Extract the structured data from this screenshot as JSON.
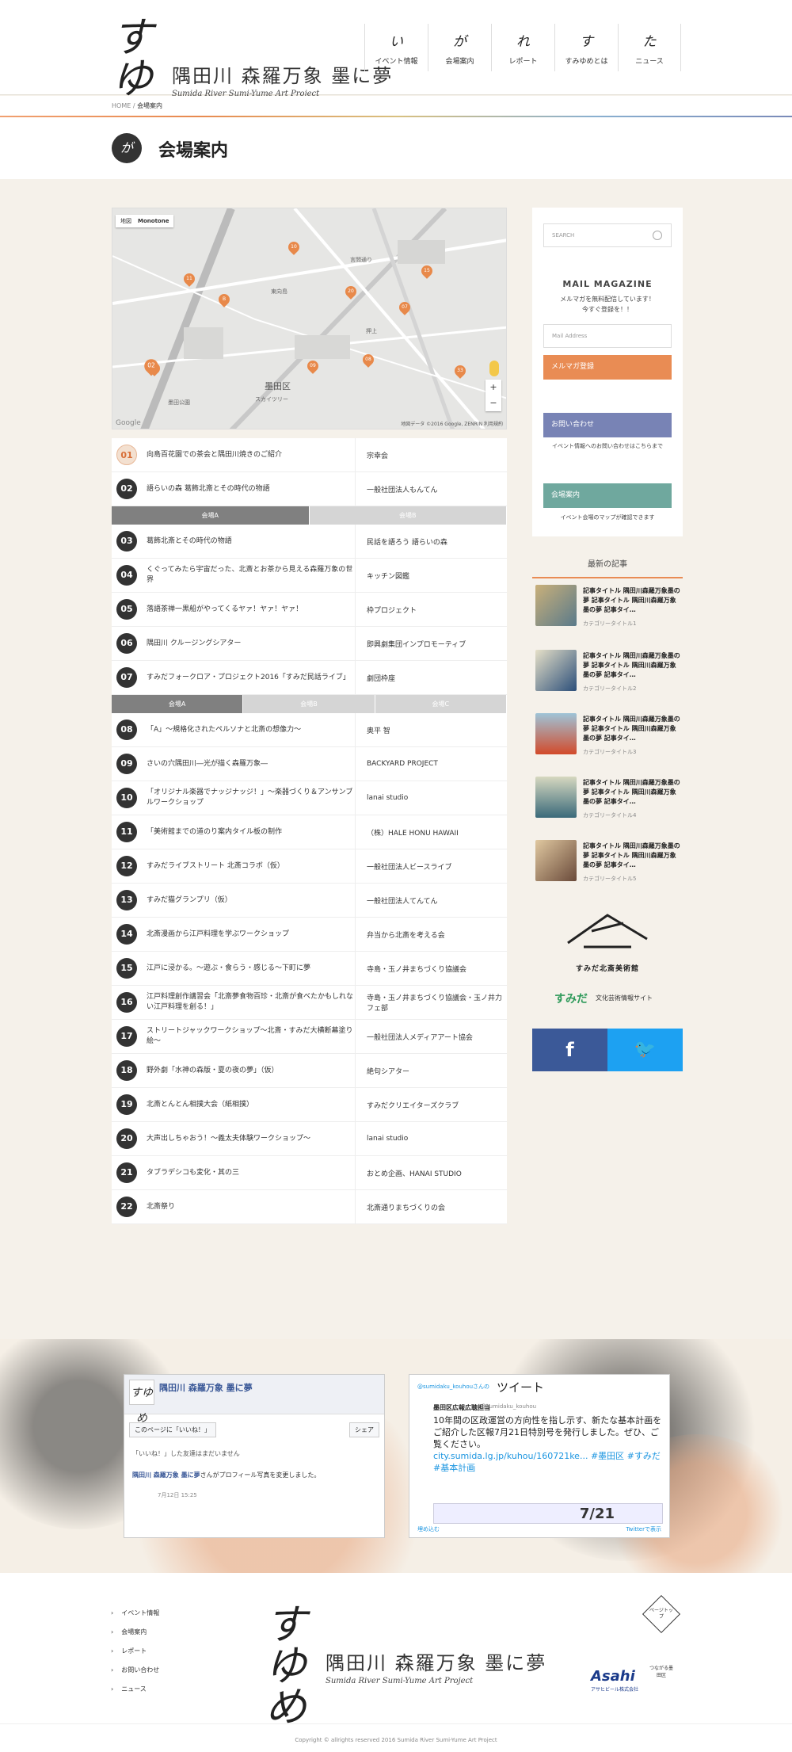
{
  "header": {
    "logo_mark": "すゆめ",
    "logo_jp": "隅田川 森羅万象 墨に夢",
    "logo_en": "Sumida River Sumi-Yume Art Project",
    "nav": [
      {
        "kana": "い",
        "label": "イベント情報"
      },
      {
        "kana": "が",
        "label": "会場案内"
      },
      {
        "kana": "れ",
        "label": "レポート"
      },
      {
        "kana": "す",
        "label": "すみゆめとは"
      },
      {
        "kana": "た",
        "label": "ニュース"
      }
    ]
  },
  "breadcrumb": {
    "home": "HOME",
    "sep": " / ",
    "current": "会場案内"
  },
  "page": {
    "icon": "が",
    "title": "会場案内"
  },
  "map": {
    "type_label": "地図",
    "style_label": "Monotone",
    "ward_label": "墨田区",
    "credit": "地図データ ©2016 Google, ZENRIN 利用規約",
    "google": "Google",
    "area_labels": [
      "東向島",
      "押上",
      "スカイツリー",
      "言問通り",
      "墨田公園"
    ],
    "pins": [
      "A",
      "B",
      "02",
      "11",
      "10",
      "20",
      "07",
      "15",
      "09",
      "08",
      "33"
    ]
  },
  "list_top": [
    {
      "num": "01",
      "event": "向島百花園での茶会と隅田川焼きのご紹介",
      "org": "宗幸会",
      "highlight": true
    },
    {
      "num": "02",
      "event": "語らいの森 葛飾北斎とその時代の物語",
      "org": "一般社団法人もんてん",
      "highlight": false
    }
  ],
  "tabs_1": [
    "会場A",
    "会場B"
  ],
  "list_mid": [
    {
      "num": "03",
      "event": "葛飾北斎とその時代の物語",
      "org": "民話を語ろう 語らいの森"
    },
    {
      "num": "04",
      "event": "くぐってみたら宇宙だった、北斎とお茶から見える森羅万象の世界",
      "org": "キッチン図鑑"
    },
    {
      "num": "05",
      "event": "落語茶禅一黒船がやってくるヤァ！ヤァ！ヤァ！",
      "org": "枠プロジェクト"
    },
    {
      "num": "06",
      "event": "隅田川 クルージングシアター",
      "org": "即興劇集団インプロモーティブ"
    },
    {
      "num": "07",
      "event": "すみだフォークロア・プロジェクト2016「すみだ民話ライブ」",
      "org": "劇団枠座"
    }
  ],
  "tabs_2": [
    "会場A",
    "会場B",
    "会場C"
  ],
  "list_bottom": [
    {
      "num": "08",
      "event": "「A」～規格化されたペルソナと北斎の想像力～",
      "org": "奥平 智"
    },
    {
      "num": "09",
      "event": "さいの穴隅田川―光が描く森羅万象―",
      "org": "BACKYARD PROJECT"
    },
    {
      "num": "10",
      "event": "「オリジナル楽器でナッジナッジ！」～楽器づくり＆アンサンブルワークショップ",
      "org": "lanai studio"
    },
    {
      "num": "11",
      "event": "「美術館までの道のり案内タイル板の制作",
      "org": "（株）HALE HONU HAWAII"
    },
    {
      "num": "12",
      "event": "すみだライブストリート 北斎コラボ（仮）",
      "org": "一般社団法人ビースライブ"
    },
    {
      "num": "13",
      "event": "すみだ猫グランプリ（仮）",
      "org": "一般社団法人てんてん"
    },
    {
      "num": "14",
      "event": "北斎漫画から江戸料理を学ぶワークショップ",
      "org": "弁当から北斎を考える会"
    },
    {
      "num": "15",
      "event": "江戸に浸かる。～遊ぶ・食らう・感じる～下町に夢",
      "org": "寺島・玉ノ井まちづくり協議会"
    },
    {
      "num": "16",
      "event": "江戸料理創作講習会「北斎夢食物百珍・北斎が食べたかもしれない江戸料理を創る！」",
      "org": "寺島・玉ノ井まちづくり協議会・玉ノ井力フェ部"
    },
    {
      "num": "17",
      "event": "ストリートジャックワークショップ～北斎・すみだ大横断幕塗り絵～",
      "org": "一般社団法人メディアアート協会"
    },
    {
      "num": "18",
      "event": "野外劇「水神の森版・夏の夜の夢」（仮）",
      "org": "絶句シアター"
    },
    {
      "num": "19",
      "event": "北斎とんとん相撲大会（紙相撲）",
      "org": "すみだクリエイターズクラブ"
    },
    {
      "num": "20",
      "event": "大声出しちゃおう！～義太夫体験ワークショップ～",
      "org": "lanai studio"
    },
    {
      "num": "21",
      "event": "タブラデシコも変化・其の三",
      "org": "おとめ企画、HANAI STUDIO"
    },
    {
      "num": "22",
      "event": "北斎祭り",
      "org": "北斎通りまちづくりの会"
    }
  ],
  "sidebar": {
    "search_placeholder": "SEARCH",
    "mm_title": "MAIL MAGAZINE",
    "mm_text_1": "メルマガを無料配信しています！",
    "mm_text_2": "今すぐ登録を！！",
    "mm_placeholder": "Mail Address",
    "mm_button": "メルマガ登録",
    "contact_button": "お問い合わせ",
    "contact_sub": "イベント情報へのお問い合わせはこちらまで",
    "venue_button": "会場案内",
    "venue_sub": "イベント会場のマップが確認できます"
  },
  "recent": {
    "title": "最新の記事",
    "items": [
      {
        "title": "記事タイトル 隅田川森羅万象墨の夢 記事タイトル 隅田川森羅万象墨の夢 記事タイ…",
        "cat": "カテゴリータイトル1"
      },
      {
        "title": "記事タイトル 隅田川森羅万象墨の夢 記事タイトル 隅田川森羅万象墨の夢 記事タイ…",
        "cat": "カテゴリータイトル2"
      },
      {
        "title": "記事タイトル 隅田川森羅万象墨の夢 記事タイトル 隅田川森羅万象墨の夢 記事タイ…",
        "cat": "カテゴリータイトル3"
      },
      {
        "title": "記事タイトル 隅田川森羅万象墨の夢 記事タイトル 隅田川森羅万象墨の夢 記事タイ…",
        "cat": "カテゴリータイトル4"
      },
      {
        "title": "記事タイトル 隅田川森羅万象墨の夢 記事タイトル 隅田川森羅万象墨の夢 記事タイ…",
        "cat": "カテゴリータイトル5"
      }
    ]
  },
  "partners": {
    "hokusai": "すみだ北斎美術館",
    "sumida": "すみだ",
    "sumida_sub": "文化芸術情報サイト",
    "fb": "f",
    "tw": "🐦"
  },
  "fb_widget": {
    "name": "隅田川 森羅万象 墨に夢",
    "like": "このページに「いいね！」",
    "share": "シェア",
    "none": "「いいね！」した友達はまだいません",
    "post_name": "隅田川 森羅万象 墨に夢",
    "post_text": "さんがプロフィール写真を変更しました。",
    "date": "7月12日 15:25"
  },
  "tw_widget": {
    "head": "@sumidaku_kouhouさんの",
    "title": "ツイート",
    "name": "墨田区広報広聴担当",
    "handle": "@sumidaku_kouhou",
    "text": "10年間の区政運営の方向性を指し示す、新たな基本計画をご紹介した区報7月21日特別号を発行しました。ぜひ、ご覧ください。",
    "link": "city.sumida.lg.jp/kuhou/160721ke...",
    "tags": "#墨田区 #すみだ #基本計画",
    "img_text": "7/21",
    "embed": "埋め込む",
    "view": "Twitterで表示"
  },
  "footer": {
    "menu": [
      "イベント情報",
      "会場案内",
      "レポート",
      "お問い合わせ",
      "ニュース"
    ],
    "pagetop": "ページトップ",
    "asahi": "Asahi",
    "asahi_sub": "アサヒビール株式会社",
    "ward": "つながる墨田区",
    "copyright": "Copyright © allrights reserved 2016 Sumida River Sumi-Yume Art Project"
  }
}
